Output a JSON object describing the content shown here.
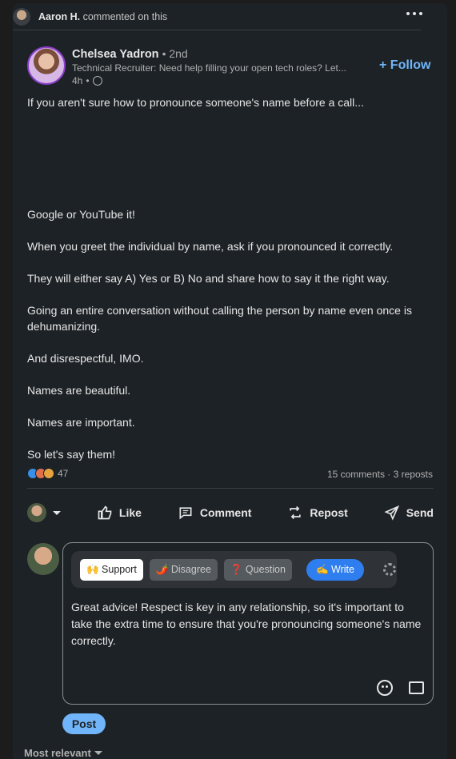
{
  "activity": {
    "actor": "Aaron H.",
    "action": "commented on this"
  },
  "author": {
    "name": "Chelsea Yadron",
    "degree": "2nd",
    "headline": "Technical Recruiter: Need help filling your open tech roles? Let...",
    "time": "4h",
    "follow_label": "Follow"
  },
  "post": {
    "lines": [
      "If you aren't sure how to pronounce someone's name before a call...",
      "Google or YouTube it!",
      "When you greet the individual by name, ask if you pronounced it correctly.",
      "They will either say A) Yes or B) No and share how to say it the right way.",
      "Going an entire conversation without calling the person by name even once is dehumanizing.",
      "And disrespectful, IMO.",
      "Names are beautiful.",
      "Names are important.",
      "So let's say them!"
    ]
  },
  "social": {
    "reaction_count": "47",
    "counts_text": "15 comments · 3 reposts"
  },
  "actions": {
    "like": "Like",
    "comment": "Comment",
    "repost": "Repost",
    "send": "Send"
  },
  "composer": {
    "chips": {
      "support": "🙌 Support",
      "disagree": "🌶️ Disagree",
      "question": "❓ Question",
      "write": "✍️ Write"
    },
    "text": "Great advice! Respect is key in any relationship, so it's important to take the extra time to ensure that you're pronouncing someone's name correctly.",
    "post_label": "Post"
  },
  "sort_label": "Most relevant"
}
